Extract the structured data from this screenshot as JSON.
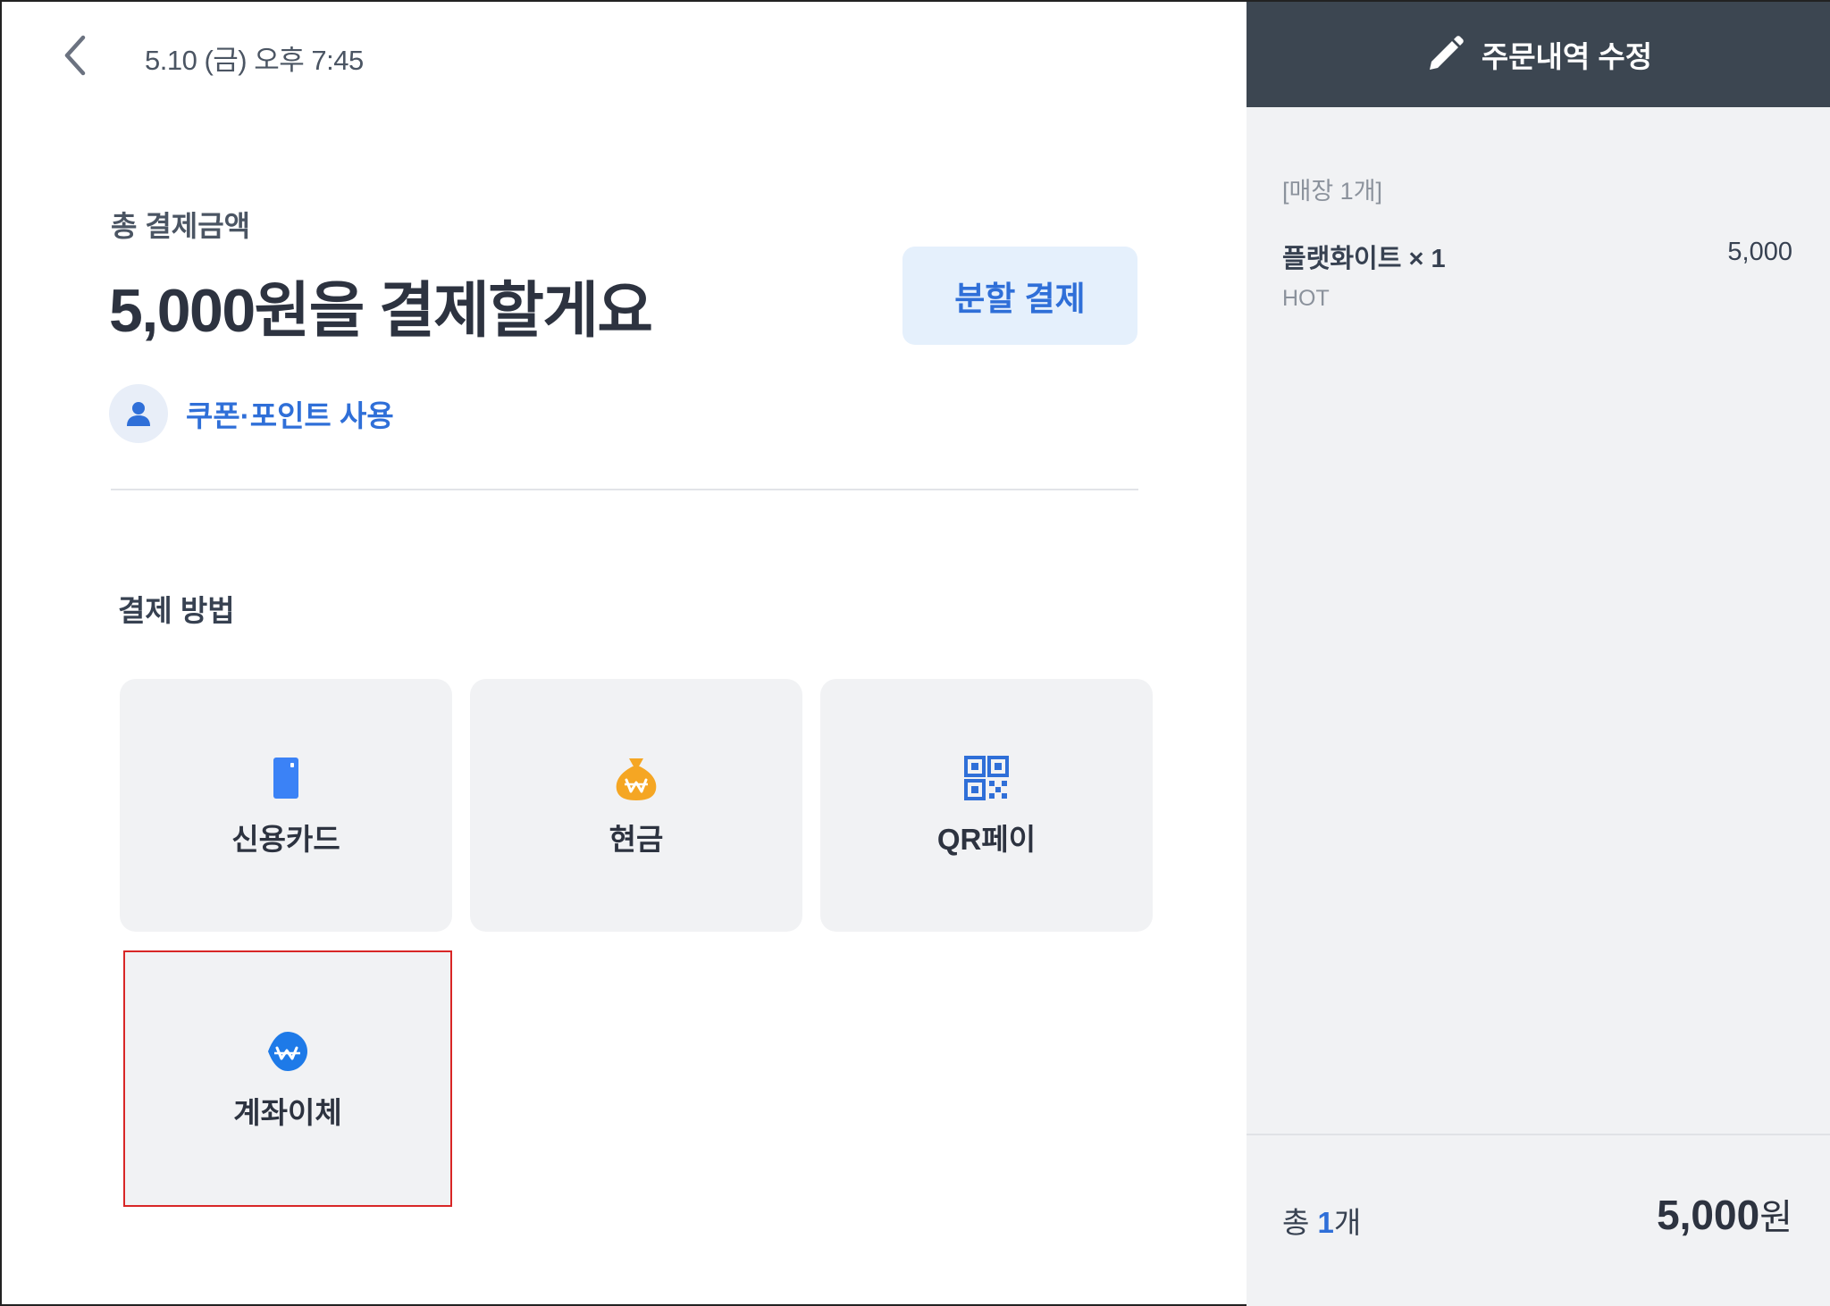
{
  "header": {
    "datetime": "5.10 (금) 오후 7:45",
    "back_icon": "chevron-left-icon"
  },
  "payment": {
    "total_label": "총 결제금액",
    "total_text": "5,000원을 결제할게요",
    "split_label": "분할 결제",
    "coupon_label": "쿠폰·포인트 사용"
  },
  "methods": {
    "section_label": "결제 방법",
    "items": [
      {
        "label": "신용카드",
        "icon": "credit-card-icon",
        "color": "#3b82f6"
      },
      {
        "label": "현금",
        "icon": "money-bag-icon",
        "color": "#f5a623"
      },
      {
        "label": "QR페이",
        "icon": "qr-code-icon",
        "color": "#2f6fd8"
      },
      {
        "label": "계좌이체",
        "icon": "bank-transfer-icon",
        "color": "#1e7ae8"
      }
    ]
  },
  "order": {
    "header_title": "주문내역 수정",
    "header_icon": "pencil-icon",
    "store_tag": "[매장 1개]",
    "items": [
      {
        "name": "플랫화이트 × 1",
        "price": "5,000",
        "option": "HOT"
      }
    ],
    "count_prefix": "총",
    "count_value": "1",
    "count_suffix": "개",
    "sum_amount": "5,000",
    "sum_unit": "원"
  },
  "colors": {
    "accent": "#2f6fd8",
    "header_bg": "#3c4651",
    "panel_bg": "#f1f2f4",
    "highlight_border": "#d82626"
  }
}
